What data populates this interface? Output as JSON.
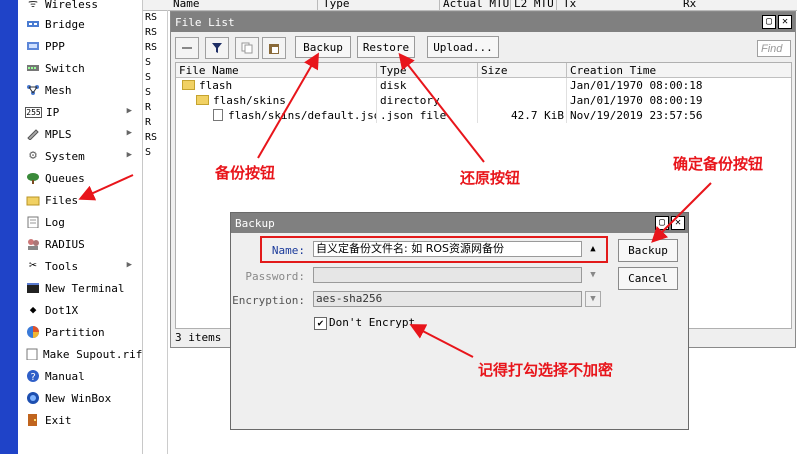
{
  "sidebar": {
    "items": [
      {
        "label": "Wireless",
        "icon": "wireless-icon",
        "sub": false
      },
      {
        "label": "Bridge",
        "icon": "bridge-icon",
        "sub": false
      },
      {
        "label": "PPP",
        "icon": "ppp-icon",
        "sub": false
      },
      {
        "label": "Switch",
        "icon": "switch-icon",
        "sub": false
      },
      {
        "label": "Mesh",
        "icon": "mesh-icon",
        "sub": false
      },
      {
        "label": "IP",
        "icon": "ip-icon",
        "sub": true
      },
      {
        "label": "MPLS",
        "icon": "mpls-icon",
        "sub": true
      },
      {
        "label": "System",
        "icon": "gear-icon",
        "sub": true
      },
      {
        "label": "Queues",
        "icon": "queues-icon",
        "sub": false
      },
      {
        "label": "Files",
        "icon": "folder-icon",
        "sub": false
      },
      {
        "label": "Log",
        "icon": "log-icon",
        "sub": false
      },
      {
        "label": "RADIUS",
        "icon": "radius-icon",
        "sub": false
      },
      {
        "label": "Tools",
        "icon": "tools-icon",
        "sub": true
      },
      {
        "label": "New Terminal",
        "icon": "terminal-icon",
        "sub": false
      },
      {
        "label": "Dot1X",
        "icon": "dot1x-icon",
        "sub": false
      },
      {
        "label": "Partition",
        "icon": "partition-icon",
        "sub": false
      },
      {
        "label": "Make Supout.rif",
        "icon": "supout-icon",
        "sub": false
      },
      {
        "label": "Manual",
        "icon": "help-icon",
        "sub": false
      },
      {
        "label": "New WinBox",
        "icon": "winbox-icon",
        "sub": false
      },
      {
        "label": "Exit",
        "icon": "exit-icon",
        "sub": false
      }
    ]
  },
  "bg_table": {
    "headers": [
      "Name",
      "Type",
      "Actual MTU",
      "L2 MTU",
      "Tx",
      "Rx"
    ],
    "flags": [
      "RS",
      "RS",
      "RS",
      "S",
      "S",
      "S",
      "R",
      "R",
      "RS",
      "S"
    ]
  },
  "file_list": {
    "title": "File List",
    "toolbar": {
      "backup": "Backup",
      "restore": "Restore",
      "upload": "Upload...",
      "find_placeholder": "Find"
    },
    "columns": [
      "File Name",
      "Type",
      "Size",
      "Creation Time"
    ],
    "rows": [
      {
        "name": "flash",
        "type": "disk",
        "size": "",
        "created": "Jan/01/1970 08:00:18"
      },
      {
        "name": "flash/skins",
        "type": "directory",
        "size": "",
        "created": "Jan/01/1970 08:00:19"
      },
      {
        "name": "flash/skins/default.json",
        "type": ".json file",
        "size": "42.7 KiB",
        "created": "Nov/19/2019 23:57:56"
      }
    ],
    "status": "3 items"
  },
  "backup_dialog": {
    "title": "Backup",
    "name_label": "Name:",
    "name_value": "自义定备份文件名:        如 ROS资源网备份",
    "password_label": "Password:",
    "password_value": "",
    "encryption_label": "Encryption:",
    "encryption_value": "aes-sha256",
    "dont_encrypt_label": "Don't Encrypt",
    "dont_encrypt_checked": true,
    "backup_button": "Backup",
    "cancel_button": "Cancel"
  },
  "annotations": {
    "backup_btn": "备份按钮",
    "restore_btn": "还原按钮",
    "confirm_btn": "确定备份按钮",
    "check_note": "记得打勾选择不加密",
    "color": "#e8151b"
  }
}
